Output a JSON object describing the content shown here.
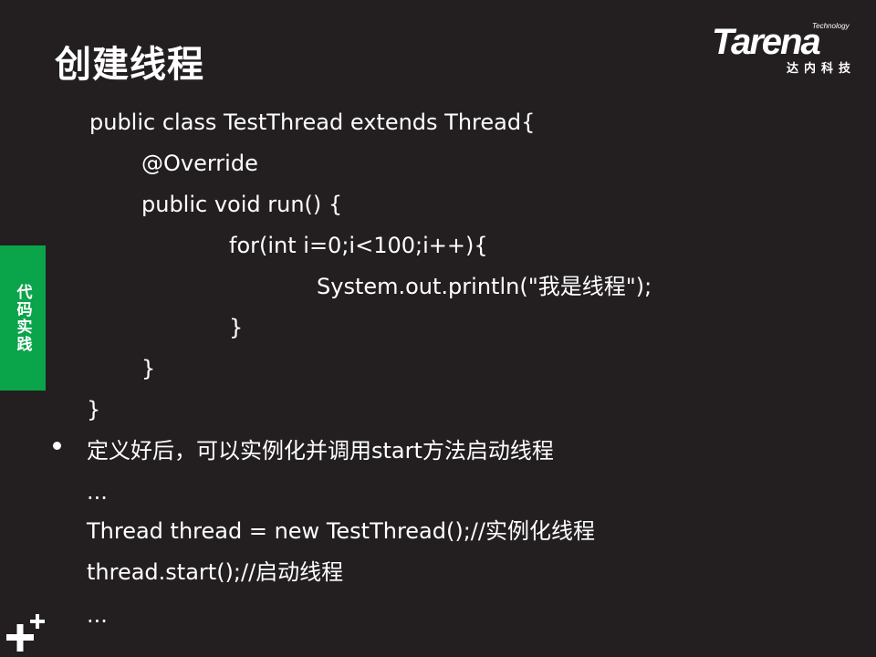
{
  "slide": {
    "title": "创建线程",
    "side_tab": "代码实践",
    "logo": {
      "tagline": "Technology",
      "wordmark": "Tarena",
      "subtitle": "达内科技"
    },
    "code_lines": [
      " public class TestThread extends Thread{",
      "@Override",
      "public void run() {",
      "for(int i=0;i<100;i++){",
      "System.out.println(\"我是线程\");",
      "}",
      "}",
      "}"
    ],
    "bullet": "定义好后，可以实例化并调用start方法启动线程",
    "example_lines": [
      "...",
      "Thread thread = new TestThread();//实例化线程",
      "thread.start();//启动线程",
      "..."
    ]
  },
  "colors": {
    "background": "#231f20",
    "text": "#ffffff",
    "accent_green": "#0aa44a"
  },
  "icons": {
    "corner": "plus-icon"
  }
}
